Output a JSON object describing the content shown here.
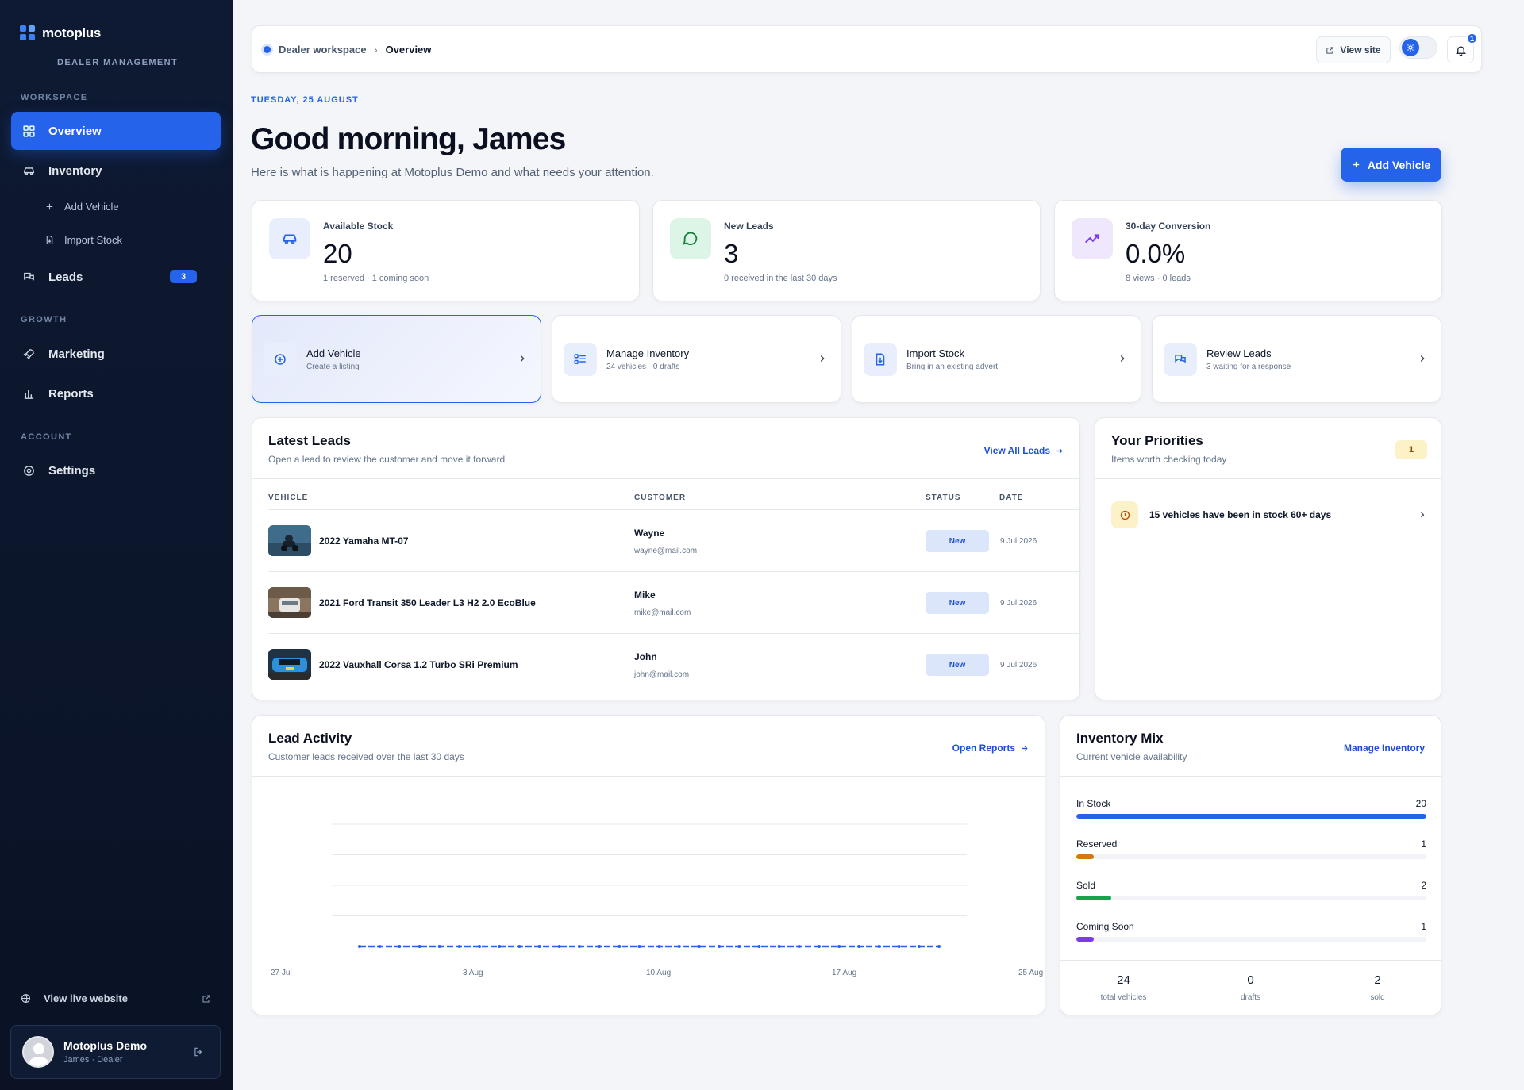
{
  "sidebar": {
    "brand": "motoplus",
    "brand_sub": "DEALER MANAGEMENT",
    "sections": {
      "workspace": "WORKSPACE",
      "growth": "GROWTH",
      "account": "ACCOUNT"
    },
    "items": {
      "overview": "Overview",
      "inventory": "Inventory",
      "add_vehicle": "Add Vehicle",
      "import_stock": "Import Stock",
      "leads": "Leads",
      "leads_count": "3",
      "marketing": "Marketing",
      "reports": "Reports",
      "settings": "Settings"
    },
    "view_live": "View live website",
    "user": {
      "name": "Motoplus Demo",
      "role": "James · Dealer"
    }
  },
  "topbar": {
    "crumb_workspace": "Dealer workspace",
    "crumb_current": "Overview",
    "view_site": "View site",
    "notification_count": "1"
  },
  "header": {
    "date": "TUESDAY, 25 AUGUST",
    "greeting": "Good morning, James",
    "subtitle": "Here is what is happening at Motoplus Demo and what needs your attention.",
    "add_vehicle": "Add Vehicle"
  },
  "stats": [
    {
      "label": "Available Stock",
      "value": "20",
      "sub": "1 reserved · 1 coming soon"
    },
    {
      "label": "New Leads",
      "value": "3",
      "sub": "0 received in the last 30 days"
    },
    {
      "label": "30-day Conversion",
      "value": "0.0%",
      "sub": "8 views · 0 leads"
    }
  ],
  "quick_actions": [
    {
      "title": "Add Vehicle",
      "sub": "Create a listing"
    },
    {
      "title": "Manage Inventory",
      "sub": "24 vehicles · 0 drafts"
    },
    {
      "title": "Import Stock",
      "sub": "Bring in an existing advert"
    },
    {
      "title": "Review Leads",
      "sub": "3 waiting for a response"
    }
  ],
  "latest_leads": {
    "title": "Latest Leads",
    "subtitle": "Open a lead to review the customer and move it forward",
    "link": "View All Leads",
    "columns": {
      "vehicle": "VEHICLE",
      "customer": "CUSTOMER",
      "status": "STATUS",
      "date": "DATE"
    },
    "rows": [
      {
        "vehicle": "2022 Yamaha MT-07",
        "name": "Wayne",
        "email": "wayne@mail.com",
        "status": "New",
        "date": "9 Jul 2026"
      },
      {
        "vehicle": "2021 Ford Transit 350 Leader L3 H2 2.0 EcoBlue",
        "name": "Mike",
        "email": "mike@mail.com",
        "status": "New",
        "date": "9 Jul 2026"
      },
      {
        "vehicle": "2022 Vauxhall Corsa 1.2 Turbo SRi Premium",
        "name": "John",
        "email": "john@mail.com",
        "status": "New",
        "date": "9 Jul 2026"
      }
    ]
  },
  "priorities": {
    "title": "Your Priorities",
    "subtitle": "Items worth checking today",
    "count": "1",
    "item": "15 vehicles have been in stock 60+ days"
  },
  "lead_activity": {
    "title": "Lead Activity",
    "subtitle": "Customer leads received over the last 30 days",
    "link": "Open Reports"
  },
  "chart_data": {
    "type": "line",
    "x": [
      "27 Jul",
      "28 Jul",
      "29 Jul",
      "30 Jul",
      "31 Jul",
      "1 Aug",
      "2 Aug",
      "3 Aug",
      "4 Aug",
      "5 Aug",
      "6 Aug",
      "7 Aug",
      "8 Aug",
      "9 Aug",
      "10 Aug",
      "11 Aug",
      "12 Aug",
      "13 Aug",
      "14 Aug",
      "15 Aug",
      "16 Aug",
      "17 Aug",
      "18 Aug",
      "19 Aug",
      "20 Aug",
      "21 Aug",
      "22 Aug",
      "23 Aug",
      "24 Aug",
      "25 Aug"
    ],
    "tick_labels": [
      "27 Jul",
      "3 Aug",
      "10 Aug",
      "17 Aug",
      "25 Aug"
    ],
    "series": [
      {
        "values": [
          0,
          0,
          0,
          0,
          0,
          0,
          0,
          0,
          0,
          0,
          0,
          0,
          0,
          0,
          0,
          0,
          0,
          0,
          0,
          0,
          0,
          0,
          0,
          0,
          0,
          0,
          0,
          0,
          0,
          0
        ],
        "color": "#2563eb"
      }
    ],
    "ylim": [
      0,
      4
    ],
    "grid": true
  },
  "inventory_mix": {
    "title": "Inventory Mix",
    "subtitle": "Current vehicle availability",
    "link": "Manage Inventory",
    "max": 20,
    "rows": [
      {
        "label": "In Stock",
        "value": 20,
        "value_text": "20",
        "color": "#2563eb"
      },
      {
        "label": "Reserved",
        "value": 1,
        "value_text": "1",
        "color": "#d97706"
      },
      {
        "label": "Sold",
        "value": 2,
        "value_text": "2",
        "color": "#16a34a"
      },
      {
        "label": "Coming Soon",
        "value": 1,
        "value_text": "1",
        "color": "#7c3aed"
      }
    ],
    "totals": [
      {
        "num": "24",
        "cap": "total vehicles"
      },
      {
        "num": "0",
        "cap": "drafts"
      },
      {
        "num": "2",
        "cap": "sold"
      }
    ]
  }
}
